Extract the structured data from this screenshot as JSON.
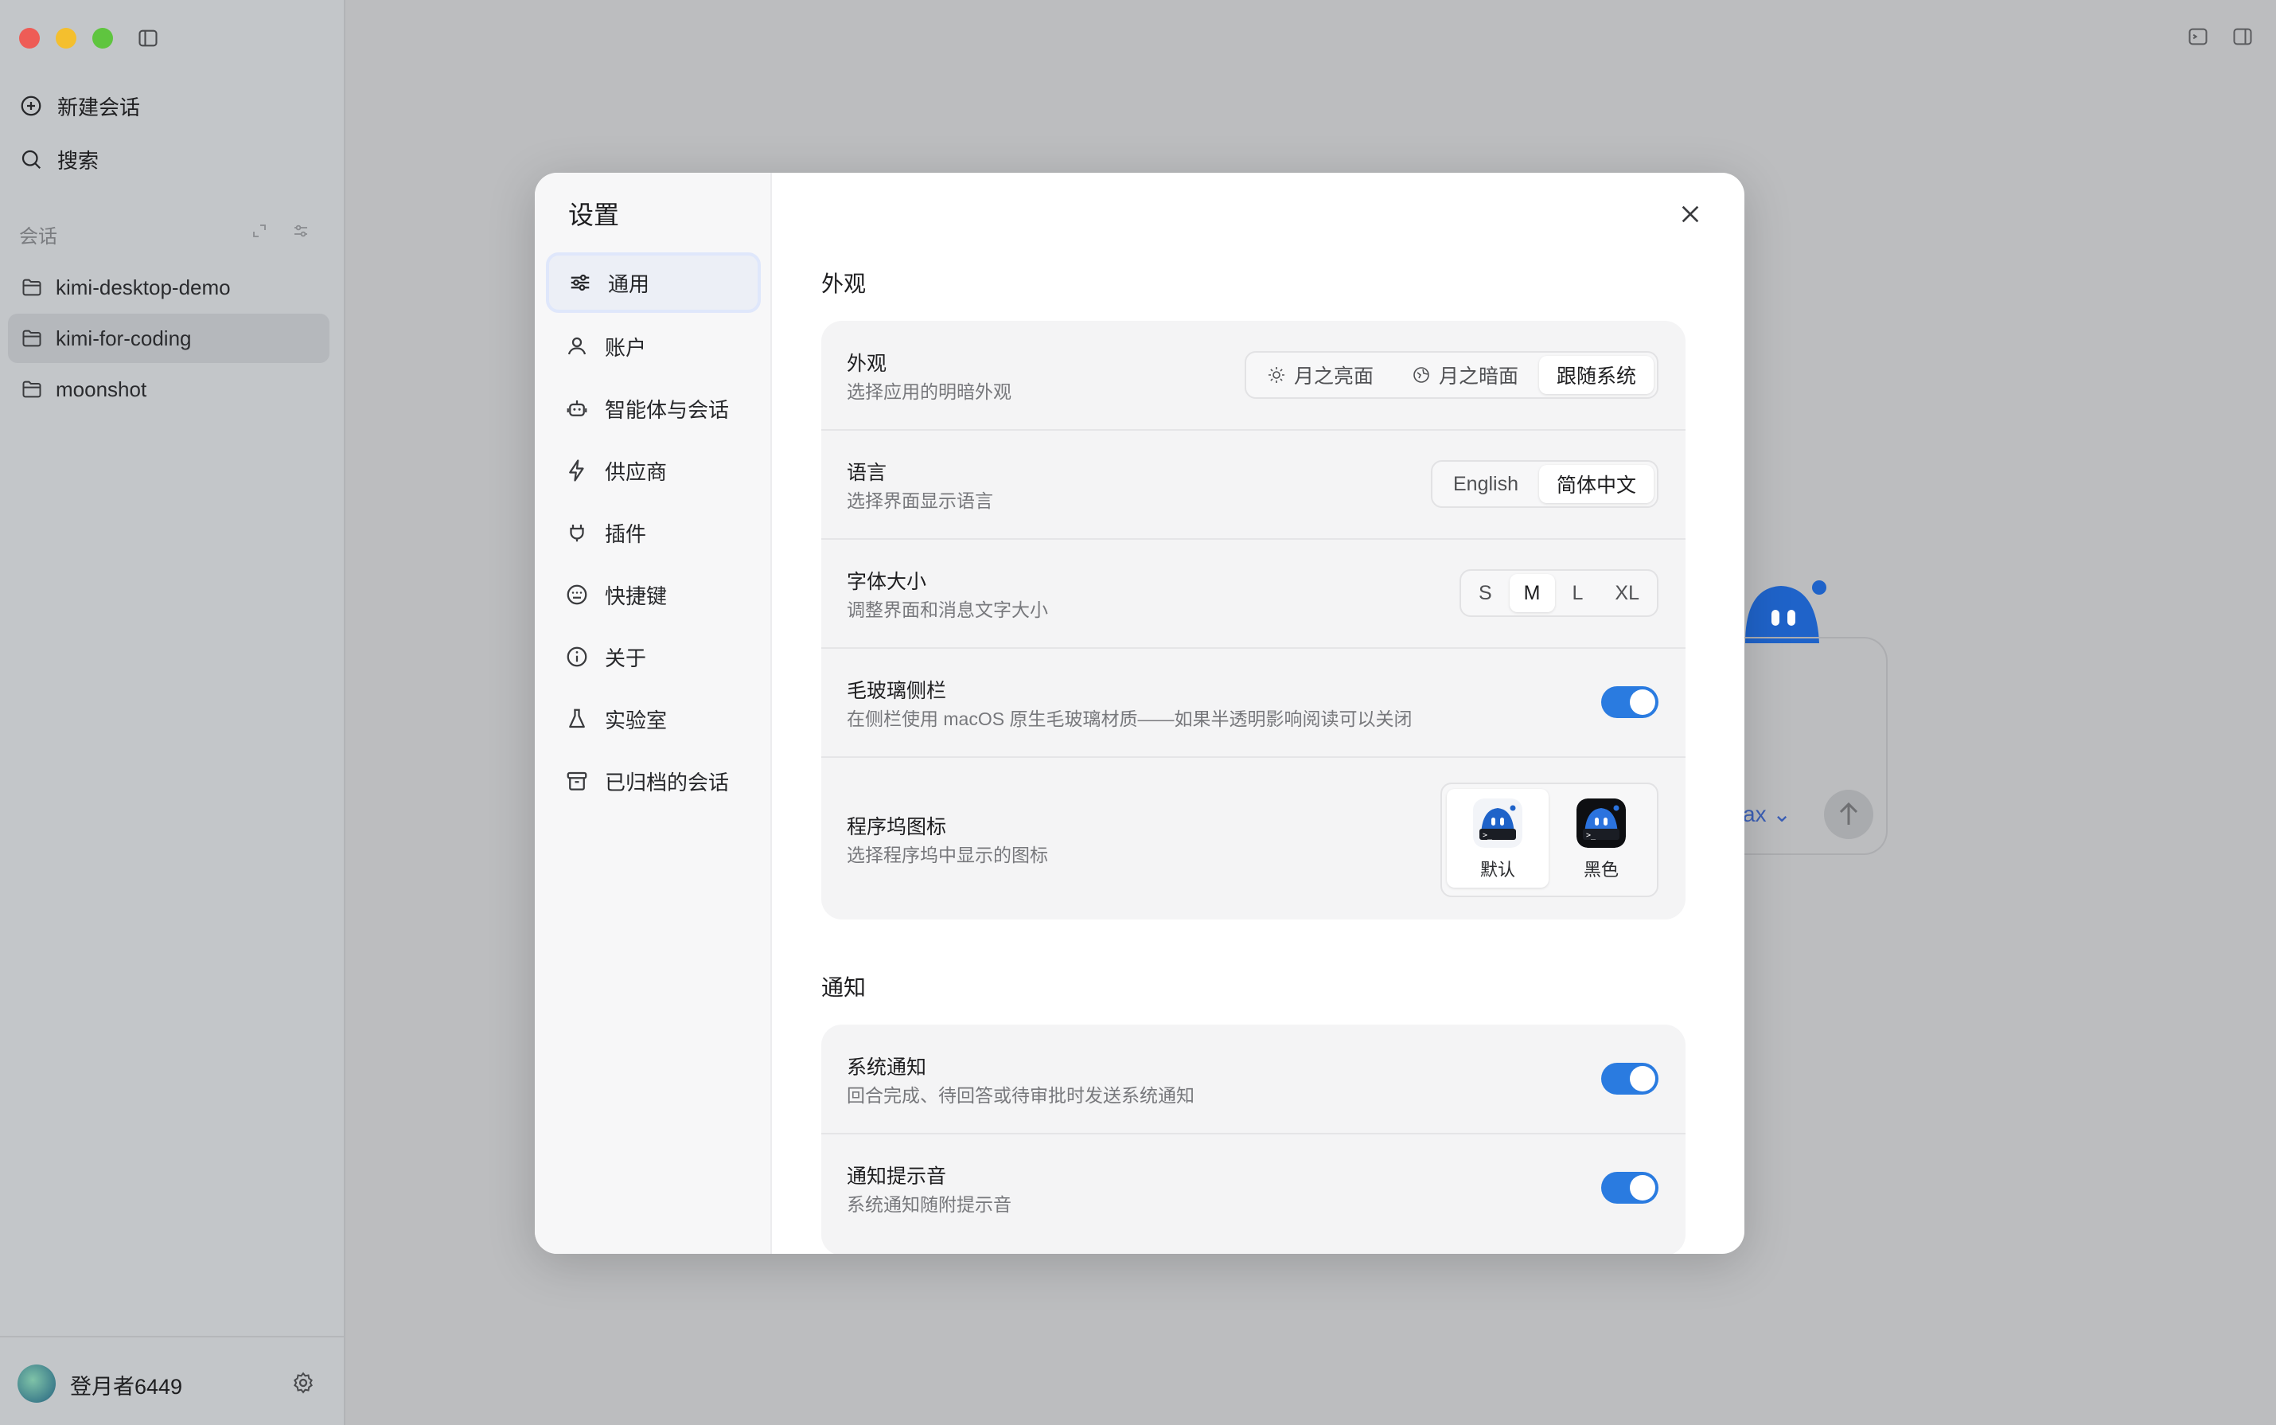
{
  "sidebar": {
    "new_chat": "新建会话",
    "search": "搜索",
    "section_label": "会话",
    "projects": [
      {
        "label": "kimi-desktop-demo"
      },
      {
        "label": "kimi-for-coding"
      },
      {
        "label": "moonshot"
      }
    ],
    "user": "登月者6449"
  },
  "background": {
    "model_fragment": "ax"
  },
  "modal": {
    "title": "设置",
    "nav": [
      {
        "label": "通用",
        "icon": "sliders-icon"
      },
      {
        "label": "账户",
        "icon": "user-icon"
      },
      {
        "label": "智能体与会话",
        "icon": "robot-icon"
      },
      {
        "label": "供应商",
        "icon": "bolt-icon"
      },
      {
        "label": "插件",
        "icon": "plugin-icon"
      },
      {
        "label": "快捷键",
        "icon": "keyboard-icon"
      },
      {
        "label": "关于",
        "icon": "info-icon"
      },
      {
        "label": "实验室",
        "icon": "flask-icon"
      },
      {
        "label": "已归档的会话",
        "icon": "archive-icon"
      }
    ],
    "appearance_group": "外观",
    "appearance": {
      "title": "外观",
      "desc": "选择应用的明暗外观",
      "options": [
        "月之亮面",
        "月之暗面",
        "跟随系统"
      ],
      "selected": "跟随系统"
    },
    "language": {
      "title": "语言",
      "desc": "选择界面显示语言",
      "options": [
        "English",
        "简体中文"
      ],
      "selected": "简体中文"
    },
    "font_size": {
      "title": "字体大小",
      "desc": "调整界面和消息文字大小",
      "options": [
        "S",
        "M",
        "L",
        "XL"
      ],
      "selected": "M"
    },
    "frosted_sidebar": {
      "title": "毛玻璃侧栏",
      "desc": "在侧栏使用 macOS 原生毛玻璃材质——如果半透明影响阅读可以关闭",
      "enabled": true
    },
    "dock_icon": {
      "title": "程序坞图标",
      "desc": "选择程序坞中显示的图标",
      "options": [
        "默认",
        "黑色"
      ],
      "selected": "默认"
    },
    "notification_group": "通知",
    "system_notification": {
      "title": "系统通知",
      "desc": "回合完成、待回答或待审批时发送系统通知",
      "enabled": true
    },
    "notification_sound": {
      "title": "通知提示音",
      "desc": "系统通知随附提示音",
      "enabled": true
    }
  },
  "colors": {
    "accent": "#2a7be0",
    "mascot": "#1f63c9"
  }
}
